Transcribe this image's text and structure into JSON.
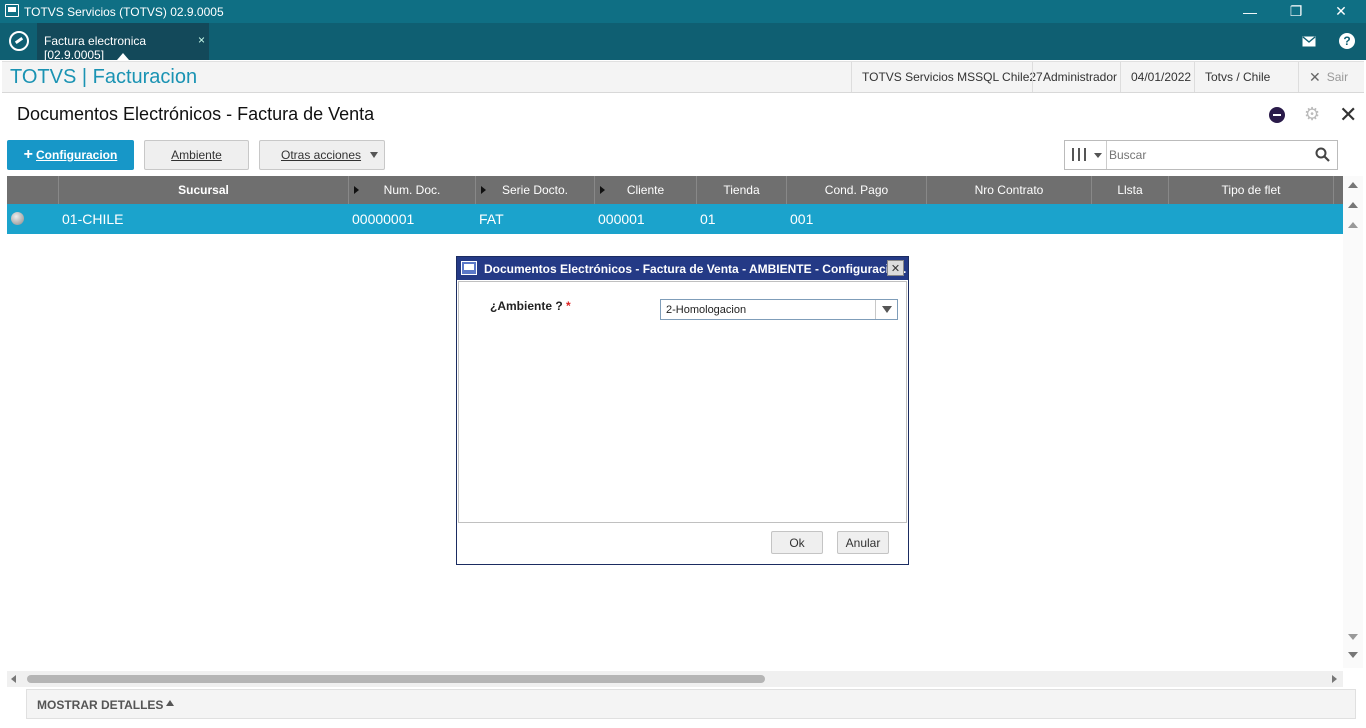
{
  "window": {
    "title": "TOTVS Servicios (TOTVS) 02.9.0005",
    "minimize": "—",
    "restore": "❐",
    "close": "✕"
  },
  "tabs": [
    {
      "label": "Factura electronica [02.9.0005]",
      "close": "×"
    }
  ],
  "header": {
    "brand": "TOTVS | Facturacion",
    "server": "TOTVS Servicios MSSQL Chile27",
    "user": "Administrador",
    "date": "04/01/2022",
    "company": "Totvs / Chile",
    "exit": "Sair"
  },
  "page": {
    "title": "Documentos Electrónicos - Factura de Venta"
  },
  "toolbar": {
    "config_label": "Configuracion",
    "ambiente_label": "Ambiente",
    "otras_label": "Otras acciones"
  },
  "search": {
    "placeholder": "Buscar"
  },
  "grid": {
    "columns": [
      "Sucursal",
      "Num. Doc.",
      "Serie Docto.",
      "Cliente",
      "Tienda",
      "Cond. Pago",
      "Nro Contrato",
      "Llsta",
      "Tipo de flet"
    ],
    "rows": [
      {
        "sucursal": "01-CHILE",
        "num_doc": "00000001",
        "serie": "FAT",
        "cliente": "000001",
        "tienda": "01",
        "cond_pago": "001",
        "contrato": "",
        "lista": "",
        "tipo_flet": ""
      }
    ]
  },
  "footer": {
    "show_details": "MOSTRAR DETALLES"
  },
  "dialog": {
    "title": "Documentos Electrónicos - Factura de Venta - AMBIENTE - Configuració...",
    "field_label": "¿Ambiente ?",
    "required_mark": "*",
    "field_value": "2-Homologacion",
    "ok_label": "Ok",
    "cancel_label": "Anular"
  },
  "colors": {
    "accent": "#1797c8",
    "selected_row": "#1ba3cc",
    "titlebar": "#0f6f84",
    "dialog_title": "#243a86"
  }
}
